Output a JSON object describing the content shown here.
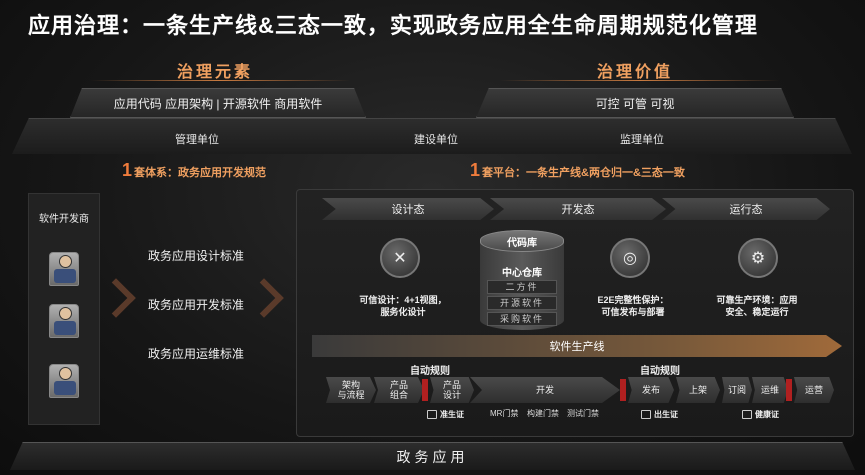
{
  "title": "应用治理：一条生产线&三态一致，实现政务应用全生命周期规范化管理",
  "governance_elements": {
    "heading": "治理元素",
    "content": "应用代码 应用架构    |    开源软件 商用软件"
  },
  "governance_value": {
    "heading": "治理价值",
    "content": "可控 可管 可视"
  },
  "units": {
    "management": "管理单位",
    "construction": "建设单位",
    "supervision": "监理单位"
  },
  "system_header": {
    "count": "1",
    "text": "套体系：政务应用开发规范"
  },
  "platform_header": {
    "count": "1",
    "text": "套平台：一条生产线&两仓归一&三态一致"
  },
  "left_panel": {
    "label": "软件开发商"
  },
  "standards": [
    "政务应用设计标准",
    "政务应用开发标准",
    "政务应用运维标准"
  ],
  "stages": [
    "设计态",
    "开发态",
    "运行态"
  ],
  "stage_descriptions": {
    "design": [
      "可信设计：4+1视图，",
      "服务化设计"
    ],
    "dev": [
      "E2E完整性保护：",
      "可信发布与部署"
    ],
    "run": [
      "可靠生产环境：应用",
      "安全、稳定运行"
    ]
  },
  "repository": {
    "code_repo": "代码库",
    "central": "中心仓库",
    "items": [
      "二方件",
      "开源软件",
      "采购软件"
    ]
  },
  "pipeline_label": "软件生产线",
  "auto_rules": [
    "自动规则",
    "自动规则"
  ],
  "steps": {
    "arch": "架构\n与流程",
    "portfolio": "产品\n组合",
    "design": "产品\n设计",
    "develop": "开发",
    "release": "发布",
    "launch": "上架",
    "subscribe": "订阅",
    "ops": "运维",
    "operation": "运营"
  },
  "certs": [
    "准生证",
    "出生证",
    "健康证"
  ],
  "gates": [
    "MR门禁",
    "构建门禁",
    "测试门禁"
  ],
  "footer": "政务应用",
  "colors": {
    "accent": "#f07c3c",
    "heading": "#f0a060",
    "gate_red": "#b02020"
  }
}
